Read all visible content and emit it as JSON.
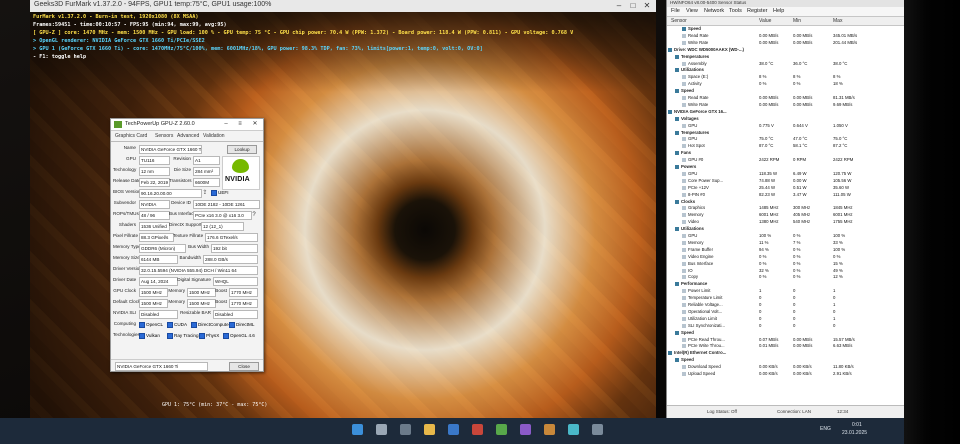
{
  "furmark": {
    "title": "Geeks3D FurMark v1.37.2.0 - 94FPS, GPU1 temp:75°C, GPU1 usage:100%",
    "lines": [
      {
        "text": "FurMark v1.37.2.0 - Burn-in test, 1920x1080 (8X MSAA)",
        "color": "#ffe04a"
      },
      {
        "text": "Frames:59451 - time:00:10:57 - FPS:95 (min:94, max:99, avg:95)",
        "color": "#ffffff"
      },
      {
        "text": "[ GPU-Z ] core: 1470 MHz - mem: 1500 MHz - GPU load: 100 % - GPU temp: 75 °C - GPU chip power: 70.4 W (PPW: 1.372) - Board power: 118.4 W (PPW: 0.811) - GPU voltage: 0.768 V",
        "color": "#ffe04a"
      },
      {
        "text": "> OpenGL renderer: NVIDIA GeForce GTX 1660 Ti/PCIe/SSE2",
        "color": "#5ad6ff"
      },
      {
        "text": "> GPU 1 (GeForce GTX 1660 Ti) - core: 1470MHz/75°C/100%, mem: 6001MHz/18%, GPU power: 98.3% TDP, fan: 73%, limits[power:1, temp:0, volt:0, OV:0]",
        "color": "#5ad6ff"
      },
      {
        "text": "- F1: toggle help",
        "color": "#ffffff"
      }
    ],
    "bottom_text": "GPU 1: 75°C (min: 37°C - max: 75°C)"
  },
  "gpuz": {
    "title": "TechPowerUp GPU-Z 2.60.0",
    "tabs": [
      "Graphics Card",
      "Sensors",
      "Advanced",
      "Validation"
    ],
    "logo": "NVIDIA",
    "lookup": "Lookup",
    "uefi": "UEFI",
    "rows": [
      {
        "label": "Name",
        "value": "NVIDIA GeForce GTX 1660 Ti"
      },
      {
        "label": "GPU",
        "value": "TU116",
        "label2": "Revision",
        "value2": "A1"
      },
      {
        "label": "Technology",
        "value": "12 nm",
        "label2": "Die Size",
        "value2": "284 mm²"
      },
      {
        "label": "Release Date",
        "value": "Feb 22, 2019",
        "label2": "Transistors",
        "value2": "6600M"
      },
      {
        "label": "BIOS Version",
        "value": "90.16.20.00.00"
      },
      {
        "label": "Subvendor",
        "value": "NVIDIA",
        "label2": "Device ID",
        "value2": "10DE 2182 - 10DE 1261"
      },
      {
        "label": "ROPs/TMUs",
        "value": "48 / 96",
        "label2": "Bus Interface",
        "value2": "PCIe x16 3.0 @ x16 3.0"
      },
      {
        "label": "Shaders",
        "value": "1536 Unified",
        "label2": "DirectX Support",
        "value2": "12 (12_1)"
      },
      {
        "label": "Pixel Fillrate",
        "value": "88.3 GPixel/s",
        "label2": "Texture Fillrate",
        "value2": "176.6 GTexel/s"
      },
      {
        "label": "Memory Type",
        "value": "GDDR6 (Micron)",
        "label2": "Bus Width",
        "value2": "192 bit"
      },
      {
        "label": "Memory Size",
        "value": "6144 MB",
        "label2": "Bandwidth",
        "value2": "288.0 GB/s"
      },
      {
        "label": "Driver Version",
        "value": "32.0.15.5594 (NVIDIA 555.94) DCH / Win11 64"
      },
      {
        "label": "Driver Date",
        "value": "Aug 14, 2024",
        "label2": "Digital Signature",
        "value2": "WHQL"
      },
      {
        "label": "GPU Clock",
        "value": "1500 MHz",
        "label2": "Memory",
        "value2": "1500 MHz",
        "label3": "Boost",
        "value3": "1770 MHz"
      },
      {
        "label": "Default Clock",
        "value": "1500 MHz",
        "label2": "Memory",
        "value2": "1500 MHz",
        "label3": "Boost",
        "value3": "1770 MHz"
      },
      {
        "label": "NVIDIA SLI",
        "value": "Disabled",
        "label2": "Resizable BAR",
        "value2": "Disabled"
      }
    ],
    "computing_label": "Computing",
    "computing": [
      "OpenCL",
      "CUDA",
      "DirectCompute",
      "DirectML"
    ],
    "technologies_label": "Technologies",
    "technologies": [
      "Vulkan",
      "Ray Tracing",
      "PhysX",
      "OpenGL 4.6"
    ],
    "footer_select": "NVIDIA GeForce GTX 1660 Ti",
    "close": "Close"
  },
  "hwinfo": {
    "title": "HWiNFO64 v8.00-5400 Sensor Status",
    "menu": [
      "File",
      "View",
      "Network",
      "Tools",
      "Register",
      "Help"
    ],
    "columns": [
      "Sensor",
      "Value",
      "Min",
      "Max"
    ],
    "rows": [
      {
        "kind": "section",
        "label": "Speed",
        "indent": 3
      },
      {
        "label": "Read Rate",
        "indent": 3,
        "v": "0.00 MB/s",
        "min": "0.00 MB/s",
        "max": "345.01 MB/s"
      },
      {
        "label": "Write Rate",
        "indent": 3,
        "v": "0.00 MB/s",
        "min": "0.00 MB/s",
        "max": "201.44 MB/s"
      },
      {
        "kind": "section",
        "label": "Drive: WDC WD5000AAKX (WD-...)",
        "indent": 1
      },
      {
        "kind": "section",
        "label": "Temperatures",
        "indent": 2
      },
      {
        "label": "Assembly",
        "indent": 3,
        "v": "38.0 °C",
        "min": "36.0 °C",
        "max": "38.0 °C"
      },
      {
        "kind": "section",
        "label": "Utilizations",
        "indent": 2
      },
      {
        "label": "Space (E:)",
        "indent": 3,
        "v": "8 %",
        "min": "8 %",
        "max": "8 %"
      },
      {
        "label": "Activity",
        "indent": 3,
        "v": "0 %",
        "min": "0 %",
        "max": "18 %"
      },
      {
        "kind": "section",
        "label": "Speed",
        "indent": 2
      },
      {
        "label": "Read Rate",
        "indent": 3,
        "v": "0.00 MB/s",
        "min": "0.00 MB/s",
        "max": "81.31 MB/s"
      },
      {
        "label": "Write Rate",
        "indent": 3,
        "v": "0.00 MB/s",
        "min": "0.00 MB/s",
        "max": "9.69 MB/s"
      },
      {
        "kind": "section",
        "label": "NVIDIA GeForce GTX 16...",
        "indent": 1
      },
      {
        "kind": "section",
        "label": "Voltages",
        "indent": 2
      },
      {
        "label": "GPU",
        "indent": 3,
        "v": "0.775 V",
        "min": "0.644 V",
        "max": "1.050 V"
      },
      {
        "kind": "section",
        "label": "Temperatures",
        "indent": 2
      },
      {
        "label": "GPU",
        "indent": 3,
        "v": "75.0 °C",
        "min": "47.0 °C",
        "max": "75.0 °C"
      },
      {
        "label": "Hot Spot",
        "indent": 3,
        "v": "87.0 °C",
        "min": "58.1 °C",
        "max": "87.2 °C"
      },
      {
        "kind": "section",
        "label": "Fans",
        "indent": 2
      },
      {
        "label": "GPU #0",
        "indent": 3,
        "v": "2422 RPM",
        "min": "0 RPM",
        "max": "2422 RPM"
      },
      {
        "kind": "section",
        "label": "Powers",
        "indent": 2
      },
      {
        "label": "GPU",
        "indent": 3,
        "v": "118.35 W",
        "min": "6.49 W",
        "max": "120.75 W"
      },
      {
        "label": "Core Power Sup...",
        "indent": 3,
        "v": "74.88 W",
        "min": "0.00 W",
        "max": "105.56 W"
      },
      {
        "label": "PCIe +12V",
        "indent": 3,
        "v": "25.44 W",
        "min": "0.51 W",
        "max": "35.60 W"
      },
      {
        "label": "8-PIN #0",
        "indent": 3,
        "v": "82.23 W",
        "min": "3.47 W",
        "max": "111.05 W"
      },
      {
        "kind": "section",
        "label": "Clocks",
        "indent": 2
      },
      {
        "label": "Graphics",
        "indent": 3,
        "v": "1485 MHz",
        "min": "300 MHz",
        "max": "1845 MHz"
      },
      {
        "label": "Memory",
        "indent": 3,
        "v": "6001 MHz",
        "min": "405 MHz",
        "max": "6001 MHz"
      },
      {
        "label": "Video",
        "indent": 3,
        "v": "1380 MHz",
        "min": "540 MHz",
        "max": "1755 MHz"
      },
      {
        "kind": "section",
        "label": "Utilizations",
        "indent": 2
      },
      {
        "label": "GPU",
        "indent": 3,
        "v": "100 %",
        "min": "0 %",
        "max": "100 %"
      },
      {
        "label": "Memory",
        "indent": 3,
        "v": "11 %",
        "min": "7 %",
        "max": "33 %"
      },
      {
        "label": "Frame Buffer",
        "indent": 3,
        "v": "94 %",
        "min": "0 %",
        "max": "100 %"
      },
      {
        "label": "Video Engine",
        "indent": 3,
        "v": "0 %",
        "min": "0 %",
        "max": "0 %"
      },
      {
        "label": "Bus Interface",
        "indent": 3,
        "v": "0 %",
        "min": "0 %",
        "max": "15 %"
      },
      {
        "label": "IO",
        "indent": 3,
        "v": "32 %",
        "min": "0 %",
        "max": "49 %"
      },
      {
        "label": "Copy",
        "indent": 3,
        "v": "0 %",
        "min": "0 %",
        "max": "12 %"
      },
      {
        "kind": "section",
        "label": "Performance",
        "indent": 2
      },
      {
        "label": "Power Limit",
        "indent": 3,
        "v": "1",
        "min": "0",
        "max": "1"
      },
      {
        "label": "Temperature Limit",
        "indent": 3,
        "v": "0",
        "min": "0",
        "max": "0"
      },
      {
        "label": "Reliable Voltage...",
        "indent": 3,
        "v": "0",
        "min": "0",
        "max": "1"
      },
      {
        "label": "Operational Volt...",
        "indent": 3,
        "v": "0",
        "min": "0",
        "max": "0"
      },
      {
        "label": "Utilization Limit",
        "indent": 3,
        "v": "0",
        "min": "0",
        "max": "1"
      },
      {
        "label": "SLI Synchronizati...",
        "indent": 3,
        "v": "0",
        "min": "0",
        "max": "0"
      },
      {
        "kind": "section",
        "label": "Speed",
        "indent": 2
      },
      {
        "label": "PCIe Read Throu...",
        "indent": 3,
        "v": "0.07 MB/s",
        "min": "0.00 MB/s",
        "max": "15.57 MB/s"
      },
      {
        "label": "PCIe Write Throu...",
        "indent": 3,
        "v": "0.01 MB/s",
        "min": "0.00 MB/s",
        "max": "6.63 MB/s"
      },
      {
        "kind": "section",
        "label": "Intel(R) Ethernet Contro...",
        "indent": 1
      },
      {
        "kind": "section",
        "label": "Speed",
        "indent": 2
      },
      {
        "label": "Download Speed",
        "indent": 3,
        "v": "0.00 KB/s",
        "min": "0.00 KB/s",
        "max": "11.80 KB/s"
      },
      {
        "label": "Upload Speed",
        "indent": 3,
        "v": "0.00 KB/s",
        "min": "0.00 KB/s",
        "max": "2.91 KB/s"
      }
    ],
    "status": [
      "Log Status: Off",
      "Connection: LAN",
      "12:34"
    ]
  },
  "taskbar": {
    "tray_lang": "ENG",
    "time": "0:01",
    "date": "23.01.2025"
  }
}
